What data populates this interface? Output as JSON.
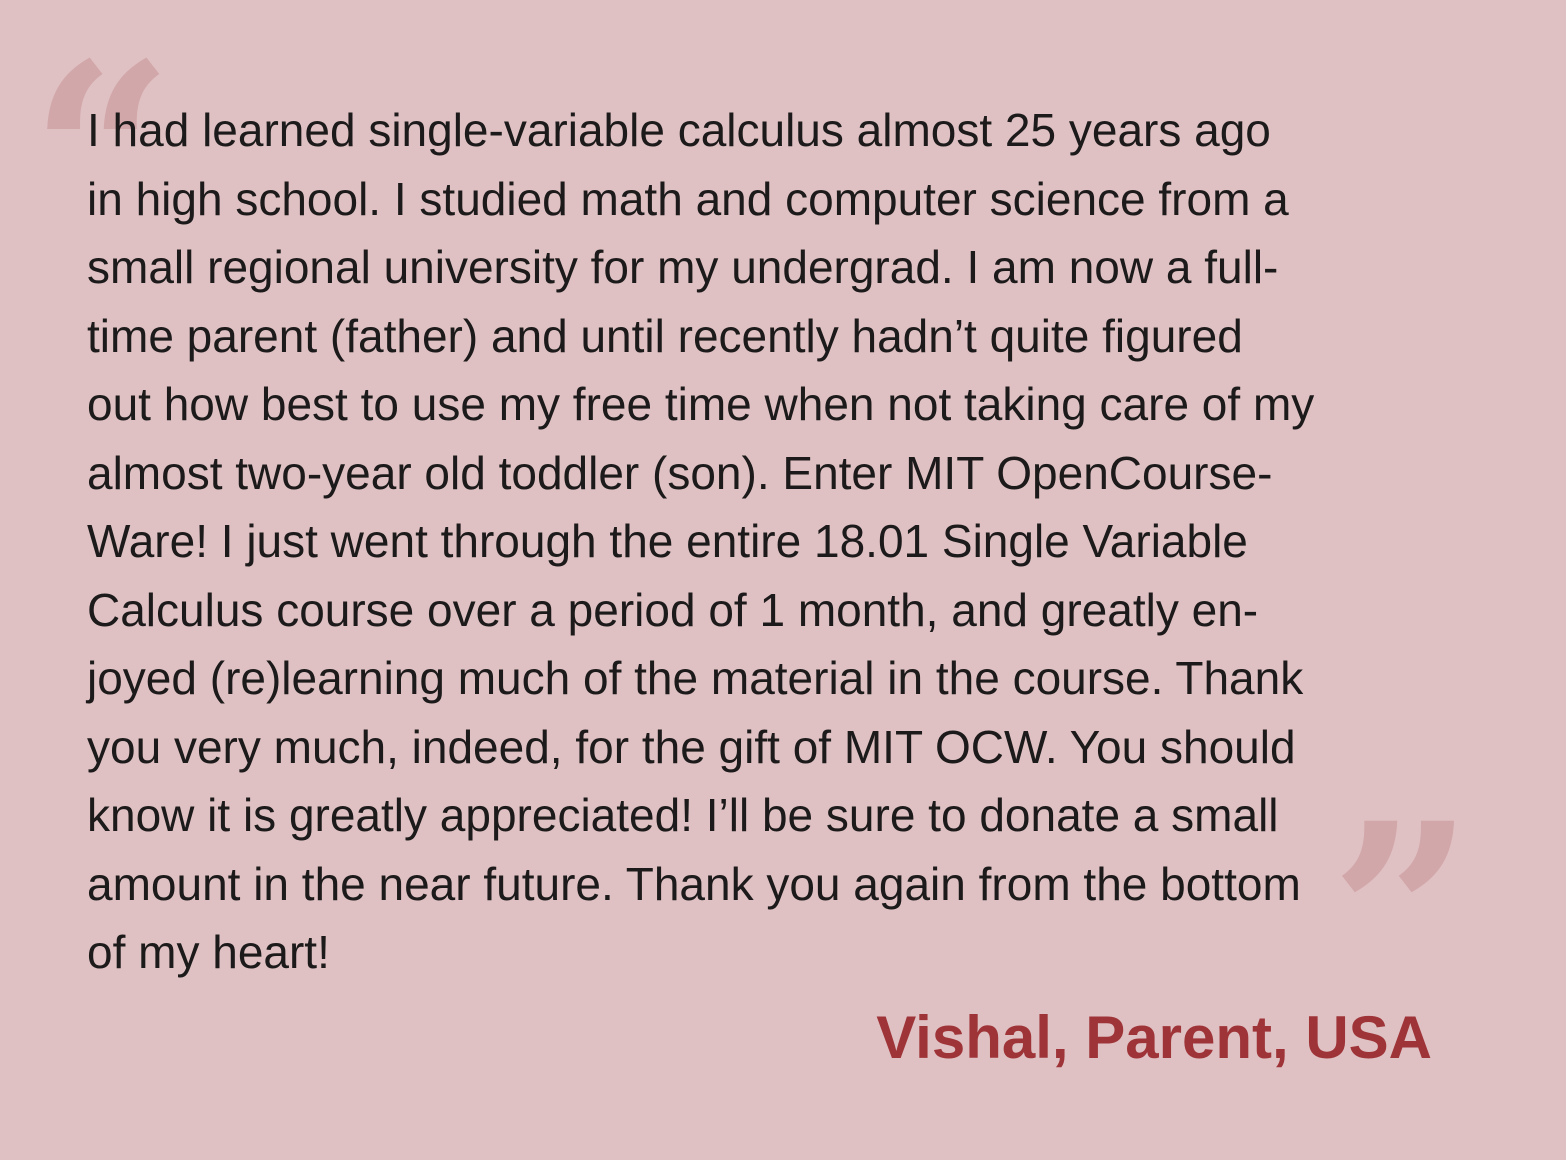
{
  "quote": {
    "open_mark": "“",
    "close_mark": "”",
    "lines": [
      "I had learned single-variable calculus almost 25 years ago",
      "in high school. I studied math and computer science from a",
      "small regional university for my undergrad. I am now a full-",
      "time parent (father) and until recently hadn’t quite figured",
      "out how best to use my free time when not taking care of my",
      "almost two-year old toddler (son). Enter MIT OpenCourse-",
      "Ware! I just went through the entire 18.01 Single Variable",
      "Calculus course over a period of 1 month, and greatly en-",
      "joyed (re)learning much of the material in the course. Thank",
      "you very much, indeed, for the gift of MIT OCW. You should",
      "know it is greatly appreciated! I’ll be sure to donate a small",
      "amount in the near future. Thank you again from the bottom",
      "of my heart!"
    ],
    "attribution": "Vishal, Parent, USA"
  },
  "colors": {
    "background": "#dfc1c3",
    "quote_mark": "#d2a7aa",
    "text": "#1c1a1a",
    "attribution": "#9e3438"
  }
}
